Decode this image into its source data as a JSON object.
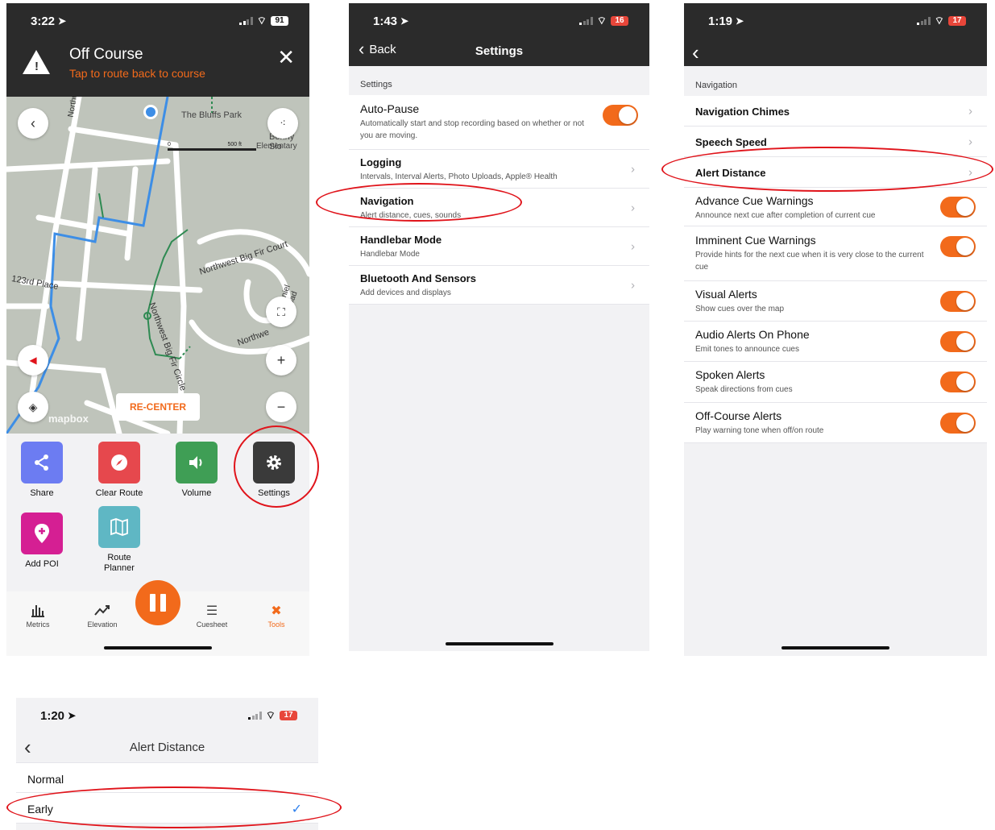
{
  "screen1": {
    "status": {
      "time": "3:22",
      "battery": "91"
    },
    "banner": {
      "title": "Off Course",
      "subtitle": "Tap to route back to course"
    },
    "map": {
      "labels": [
        "The Bluffs Park",
        "Bonny Slo",
        "Elementary",
        "Northwest Big Fir Court",
        "Northwest Big Fir Circle",
        "Northwe",
        "Daniel Road",
        "123rd Place",
        "Northw"
      ],
      "scale": {
        "zero": "0",
        "value": "500 ft"
      },
      "recenter_label": "RE-CENTER",
      "mapbox_label": "mapbox"
    },
    "tools": [
      {
        "label": "Share",
        "color": "#6c7cf2",
        "icon": "share-icon"
      },
      {
        "label": "Clear Route",
        "color": "#e6484d",
        "icon": "compass-icon"
      },
      {
        "label": "Volume",
        "color": "#3f9e55",
        "icon": "speaker-icon"
      },
      {
        "label": "Settings",
        "color": "#3a3a3a",
        "icon": "gear-icon"
      },
      {
        "label": "Add POI",
        "color": "#d51f93",
        "icon": "map-pin-icon"
      },
      {
        "label": "Route Planner",
        "color": "#5fb7c4",
        "icon": "map-icon"
      }
    ],
    "tabs": [
      "Metrics",
      "Elevation",
      "Cuesheet",
      "Tools"
    ]
  },
  "screen2": {
    "status": {
      "time": "1:43",
      "battery": "16"
    },
    "nav": {
      "back": "Back",
      "title": "Settings"
    },
    "section": "Settings",
    "rows": [
      {
        "title": "Auto-Pause",
        "sub": "Automatically start and stop recording based on whether or not you are moving."
      },
      {
        "title": "Logging",
        "sub": "Intervals, Interval Alerts, Photo Uploads, Apple® Health"
      },
      {
        "title": "Navigation",
        "sub": "Alert distance, cues, sounds"
      },
      {
        "title": "Handlebar Mode",
        "sub": "Handlebar Mode"
      },
      {
        "title": "Bluetooth And Sensors",
        "sub": "Add devices and displays"
      }
    ]
  },
  "screen3": {
    "status": {
      "time": "1:19",
      "battery": "17"
    },
    "section": "Navigation",
    "links": [
      "Navigation Chimes",
      "Speech Speed",
      "Alert Distance"
    ],
    "toggles": [
      {
        "title": "Advance Cue Warnings",
        "sub": "Announce next cue after completion of current cue"
      },
      {
        "title": "Imminent Cue Warnings",
        "sub": "Provide hints for the next cue when it is very close to the current cue"
      },
      {
        "title": "Visual Alerts",
        "sub": "Show cues over the map"
      },
      {
        "title": "Audio Alerts On Phone",
        "sub": "Emit tones to announce cues"
      },
      {
        "title": "Spoken Alerts",
        "sub": "Speak directions from cues"
      },
      {
        "title": "Off-Course Alerts",
        "sub": "Play warning tone when off/on route"
      }
    ]
  },
  "screen4": {
    "status": {
      "time": "1:20",
      "battery": "17"
    },
    "nav": {
      "title": "Alert Distance"
    },
    "options": [
      "Normal",
      "Early"
    ],
    "checkmark": "✓"
  }
}
